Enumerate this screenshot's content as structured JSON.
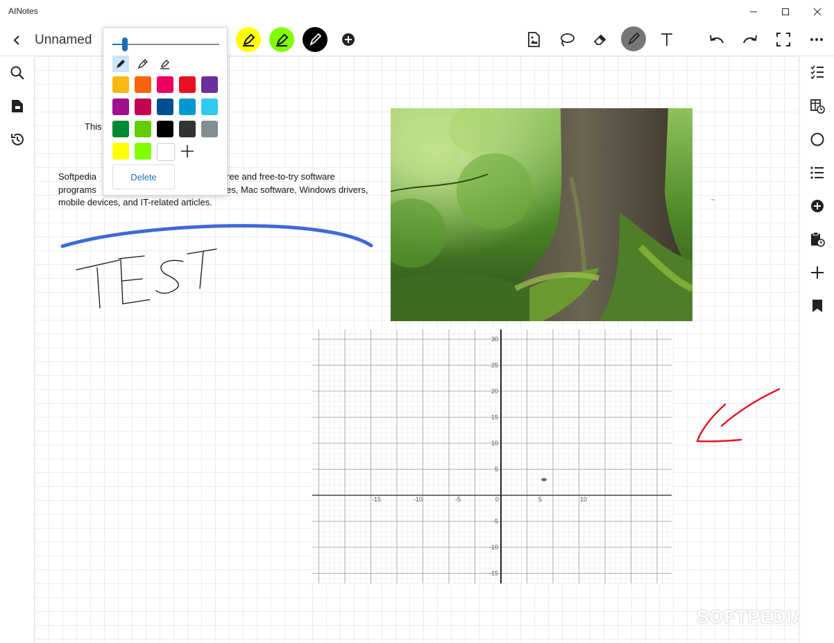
{
  "app": {
    "name": "AINotes"
  },
  "toolbar": {
    "title": "Unnamed"
  },
  "pens": [
    {
      "name": "yellow-highlighter",
      "color": "#ffff00"
    },
    {
      "name": "green-highlighter",
      "color": "#7fff00"
    },
    {
      "name": "black-pen",
      "color": "#000000"
    }
  ],
  "popup": {
    "size_fraction": 0.12,
    "colors": [
      "#fbb714",
      "#f7630c",
      "#ea005e",
      "#e81123",
      "#6b2f9c",
      "#a0108c",
      "#c30052",
      "#00508f",
      "#0098d4",
      "#2fcbf0",
      "#018936",
      "#65cb00",
      "#000000",
      "#333333",
      "#838e93",
      "#ffff00",
      "#7fff00",
      "#ffffff"
    ],
    "delete_label": "Delete"
  },
  "canvas": {
    "text_line1": "This",
    "text_para_left": [
      "Softpedia",
      "programs",
      "mobile devices, and IT-related articles."
    ],
    "text_para_right": [
      "ree and free-to-try software",
      "es, Mac software, Windows drivers,"
    ],
    "graph": {
      "y_labels": [
        "30",
        "25",
        "20",
        "15",
        "10",
        "5",
        "-5",
        "-10",
        "-15"
      ],
      "x_labels": [
        "-15",
        "-10",
        "-5",
        "0",
        "5",
        "10"
      ]
    }
  },
  "watermark": "SOFTPEDIA®",
  "icons": {
    "left": [
      "search-icon",
      "folder-icon",
      "history-icon"
    ],
    "right": [
      "checklist-icon",
      "table-clock-icon",
      "circle-icon",
      "list-icon",
      "add-circle-icon",
      "clipboard-clock-icon",
      "plus-icon",
      "bookmark-icon"
    ]
  }
}
